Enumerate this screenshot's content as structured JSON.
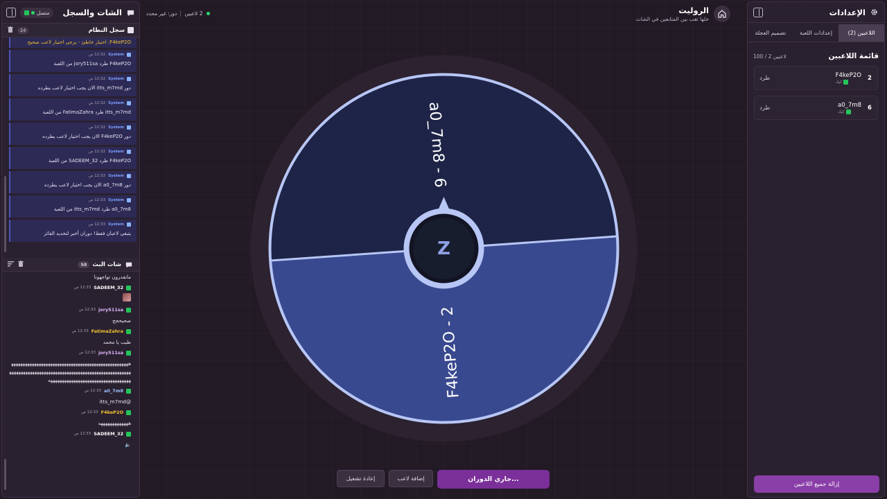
{
  "colors": {
    "accent": "#8a3ea8",
    "spin_button": "#7b2f99",
    "wheel_segment_dark": "#1d2447",
    "wheel_segment_light": "#39498f",
    "wheel_border": "#b7c6f5",
    "online_green": "#2bd56a",
    "kick_green": "#25c45a",
    "warning_yellow": "#f1c232"
  },
  "settings": {
    "title": "الإعدادات",
    "icon": "gear-icon",
    "tabs": [
      "اللاعبين (2)",
      "إعدادات اللعبة",
      "تصميم العجلة"
    ],
    "active_tab": 0,
    "players_title": "قائمة اللاعبين",
    "players_count": "100 / 2 لاعبين",
    "players": [
      {
        "number": "2",
        "name": "F4keP2O",
        "source": "كيك",
        "kick_label": "طرد"
      },
      {
        "number": "6",
        "name": "a0_7m8",
        "source": "كيك",
        "kick_label": "طرد"
      }
    ],
    "remove_all_label": "إزالة جميع اللاعبين"
  },
  "chat": {
    "title": "الشات والسجل",
    "status": "متصل",
    "system_log": {
      "title": "سجل النظام",
      "count": "24",
      "warning": "F4keP2O: اختيار خاطئ - يرجى اختيار لاعب صحيح",
      "items": [
        {
          "sender": "System",
          "time": "12:32 ص",
          "text": "F4keP2O طرد jory511sa من اللعبة"
        },
        {
          "sender": "System",
          "time": "12:32 ص",
          "text": "دور itts_m7md الان يجب اختيار لاعب يطرده"
        },
        {
          "sender": "System",
          "time": "12:32 ص",
          "text": "itts_m7md طرد FatimaZahra من اللعبة"
        },
        {
          "sender": "System",
          "time": "12:32 ص",
          "text": "دور F4keP2O الان يجب اختيار لاعب يطرده"
        },
        {
          "sender": "System",
          "time": "12:32 ص",
          "text": "F4keP2O طرد SADEEM_32 من اللعبة"
        },
        {
          "sender": "System",
          "time": "12:33 ص",
          "text": "دور a0_7m8 الان يجب اختيار لاعب يطرده"
        },
        {
          "sender": "System",
          "time": "12:33 ص",
          "text": "a0_7m8 طرد itts_m7md من اللعبة"
        },
        {
          "sender": "System",
          "time": "12:33 ص",
          "text": "يتبقى لاعبان فقط! دوران أخير لتحديد الفائز"
        }
      ]
    },
    "live_chat": {
      "title": "شات البث",
      "count": "58",
      "top_partial": "مانقدرون تواجهونا",
      "messages": [
        {
          "user": "SADEEM_32",
          "time": "12:33 ص",
          "text": "",
          "emote": true,
          "color": "#ffffff"
        },
        {
          "user": "jory511sa",
          "time": "12:33 ص",
          "text": "صحيحجح",
          "emote": false,
          "color": "#e2b8ff"
        },
        {
          "user": "FatimaZahra",
          "time": "12:33 ص",
          "text": "طيب يا محمد",
          "emote": false,
          "color": "#f1c232"
        },
        {
          "user": "jory511sa",
          "time": "12:33 ص",
          "text": "ههههههههههههههههههههههههههههههههههههههههههههههههههههههههههههههههههههههههههههههههههههههههههههههههههههههههههههههههههههههههههههههههههههههههههههه",
          "emote": false,
          "color": "#e2b8ff"
        },
        {
          "user": "a0_7m8",
          "time": "12:33 ص",
          "text": "@itts_m7md",
          "emote": false,
          "color": "#9fc2ff"
        },
        {
          "user": "F4keP2O",
          "time": "12:33 ص",
          "text": "هههههههههههههه",
          "emote": false,
          "color": "#f1c232"
        },
        {
          "user": "SADEEM_32",
          "time": "12:33 ص",
          "text": "",
          "emote": false,
          "color": "#ffffff"
        }
      ]
    }
  },
  "header": {
    "title": "الروليت",
    "subtitle": "خلها تقب بين المتابعين في الشات",
    "players_status": "2 لاعبين",
    "turn_status": "دور: غير محدد"
  },
  "wheel": {
    "segments": [
      {
        "label": "a0_7m8 - 6",
        "color": "#1d2447"
      },
      {
        "label": "F4keP2O - 2",
        "color": "#39498f"
      }
    ],
    "center_logo": "Z"
  },
  "controls": {
    "spin_label": "جاري الدوران...",
    "add_player_label": "إضافة لاعب",
    "restart_label": "إعادة تشغيل"
  }
}
